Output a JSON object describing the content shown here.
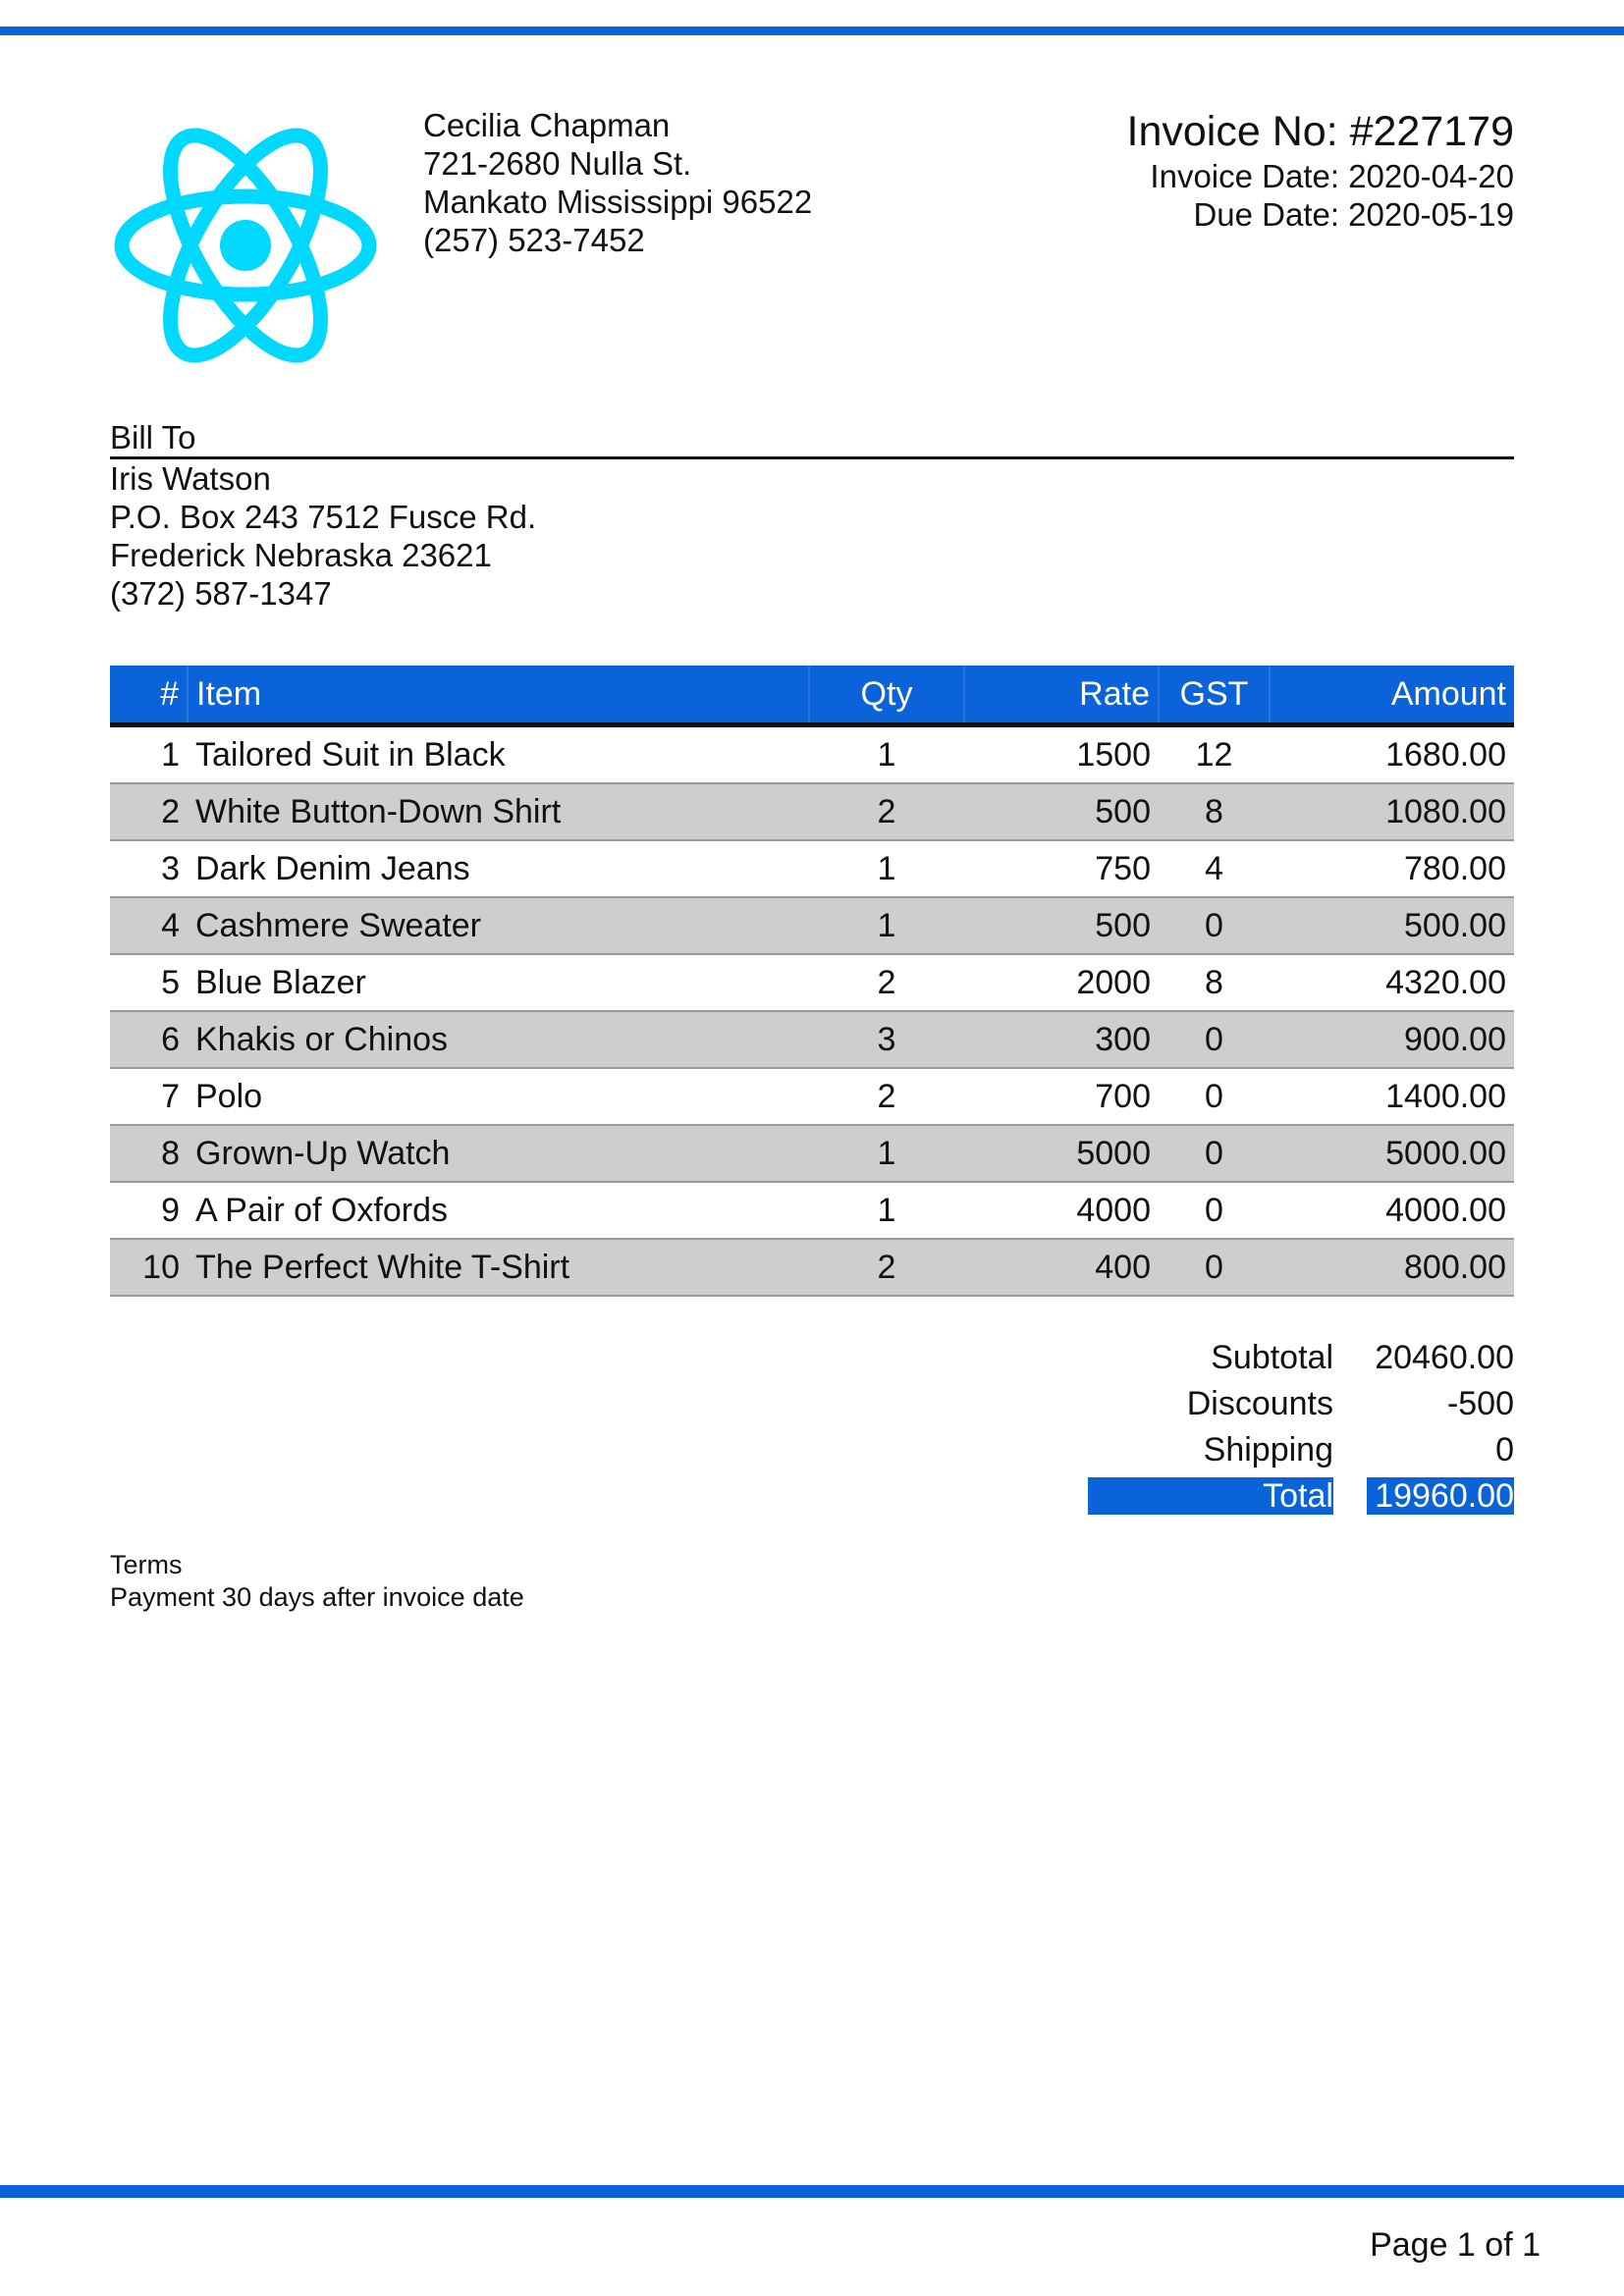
{
  "colors": {
    "accent": "#0a63d8",
    "logo": "#00d8ff",
    "row_alt": "#cecece"
  },
  "logo": {
    "icon": "react-atom-logo"
  },
  "sender": {
    "name": "Cecilia Chapman",
    "address1": "721-2680 Nulla St.",
    "address2": "Mankato Mississippi 96522",
    "phone": "(257) 523-7452"
  },
  "invoice": {
    "number": "Invoice No: #227179",
    "date": "Invoice Date: 2020-04-20",
    "due": "Due Date: 2020-05-19"
  },
  "bill_to": {
    "label": "Bill To",
    "name": "Iris Watson",
    "address1": "P.O. Box 243 7512 Fusce Rd.",
    "address2": "Frederick Nebraska 23621",
    "phone": "(372) 587-1347"
  },
  "table": {
    "headers": {
      "num": "#",
      "item": "Item",
      "qty": "Qty",
      "rate": "Rate",
      "gst": "GST",
      "amount": "Amount"
    },
    "rows": [
      {
        "num": "1",
        "item": "Tailored Suit in Black",
        "qty": "1",
        "rate": "1500",
        "gst": "12",
        "amount": "1680.00"
      },
      {
        "num": "2",
        "item": "White Button-Down Shirt",
        "qty": "2",
        "rate": "500",
        "gst": "8",
        "amount": "1080.00"
      },
      {
        "num": "3",
        "item": "Dark Denim Jeans",
        "qty": "1",
        "rate": "750",
        "gst": "4",
        "amount": "780.00"
      },
      {
        "num": "4",
        "item": "Cashmere Sweater",
        "qty": "1",
        "rate": "500",
        "gst": "0",
        "amount": "500.00"
      },
      {
        "num": "5",
        "item": "Blue Blazer",
        "qty": "2",
        "rate": "2000",
        "gst": "8",
        "amount": "4320.00"
      },
      {
        "num": "6",
        "item": "Khakis or Chinos",
        "qty": "3",
        "rate": "300",
        "gst": "0",
        "amount": "900.00"
      },
      {
        "num": "7",
        "item": "Polo",
        "qty": "2",
        "rate": "700",
        "gst": "0",
        "amount": "1400.00"
      },
      {
        "num": "8",
        "item": "Grown-Up Watch",
        "qty": "1",
        "rate": "5000",
        "gst": "0",
        "amount": "5000.00"
      },
      {
        "num": "9",
        "item": "A Pair of Oxfords",
        "qty": "1",
        "rate": "4000",
        "gst": "0",
        "amount": "4000.00"
      },
      {
        "num": "10",
        "item": "The Perfect White T-Shirt",
        "qty": "2",
        "rate": "400",
        "gst": "0",
        "amount": "800.00"
      }
    ]
  },
  "totals": {
    "subtotal_label": "Subtotal",
    "subtotal": "20460.00",
    "discounts_label": "Discounts",
    "discounts": "-500",
    "shipping_label": "Shipping",
    "shipping": "0",
    "total_label": "Total",
    "total": "19960.00"
  },
  "terms": {
    "label": "Terms",
    "text": "Payment 30 days after invoice date"
  },
  "footer": {
    "page": "Page 1 of 1"
  }
}
